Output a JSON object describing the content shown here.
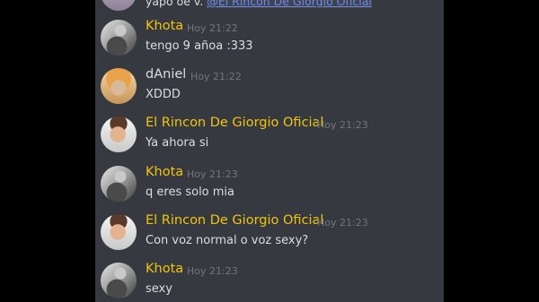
{
  "top_partial": {
    "prefix": "yapo oe v. ",
    "mention": "@El Rincon De Giorgio Oficial"
  },
  "messages": [
    {
      "author": "Khota",
      "time": "Hoy 21:22",
      "text": "tengo 9 añoa :333",
      "avatar": "khota-avatar-icon",
      "name_color": "#f1c40f"
    },
    {
      "author": "dAniel",
      "time": "Hoy 21:22",
      "text": "XDDD",
      "avatar": "daniel-avatar-icon",
      "name_color": "#dcddde"
    },
    {
      "author": "El Rincon De Giorgio Oficial",
      "time": "Hoy 21:23",
      "text": "Ya ahora si",
      "avatar": "giorgio-avatar-icon",
      "name_color": "#f1c40f"
    },
    {
      "author": "Khota",
      "time": "Hoy 21:23",
      "text": "q eres solo mia",
      "avatar": "khota-avatar-icon",
      "name_color": "#f1c40f"
    },
    {
      "author": "El Rincon De Giorgio Oficial",
      "time": "Hoy 21:23",
      "text": "Con voz normal o voz sexy?",
      "avatar": "giorgio-avatar-icon",
      "name_color": "#f1c40f"
    },
    {
      "author": "Khota",
      "time": "Hoy 21:23",
      "text": "sexy",
      "avatar": "khota-avatar-icon",
      "name_color": "#f1c40f"
    }
  ]
}
